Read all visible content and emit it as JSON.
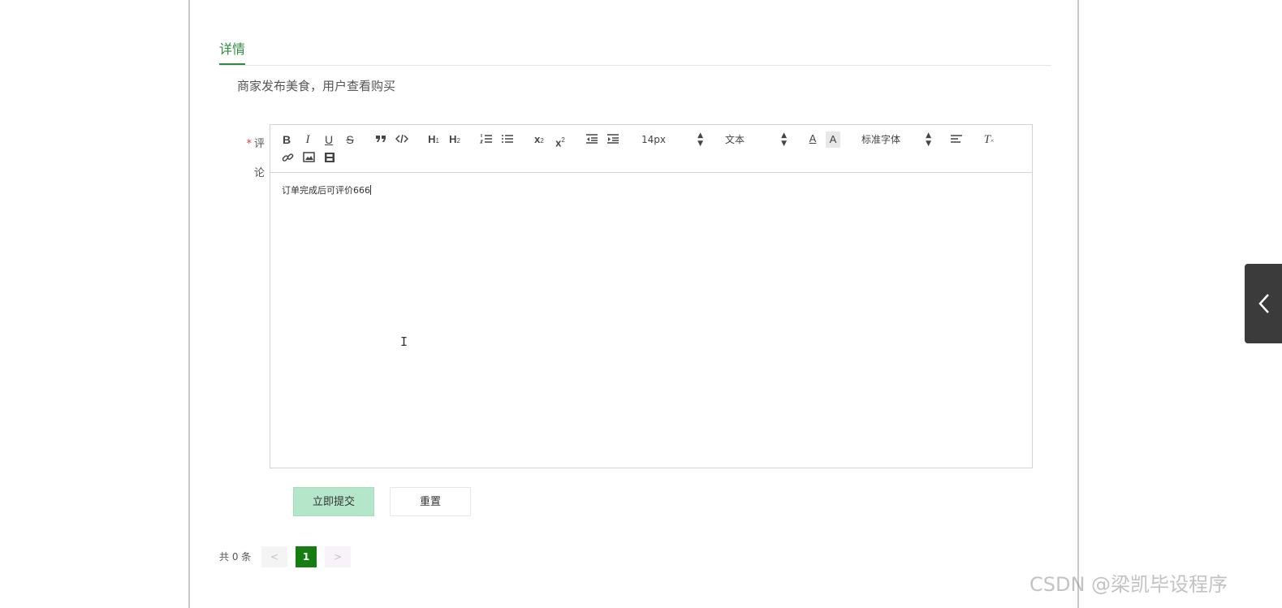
{
  "tab": {
    "title": "详情"
  },
  "description": "商家发布美食，用户查看购买",
  "form": {
    "required_mark": "*",
    "comment_label_line1": "评",
    "comment_label_line2": "论"
  },
  "editor": {
    "toolbar": {
      "bold": "B",
      "italic": "I",
      "underline": "U",
      "strike": "S",
      "h1": "H",
      "h1_sub": "1",
      "h2": "H",
      "h2_sub": "2",
      "subscript": "x",
      "subscript_sub": "2",
      "superscript": "x",
      "superscript_sup": "2",
      "size_value": "14px",
      "header_value": "文本",
      "font_value": "标准字体",
      "color_letter": "A",
      "background_letter": "A",
      "clean": "T"
    },
    "content": "订单完成后可评价666"
  },
  "buttons": {
    "submit": "立即提交",
    "reset": "重置"
  },
  "pagination": {
    "total": "共 0 条",
    "prev": "<",
    "current_page": "1",
    "next": ">"
  },
  "watermark": "CSDN @梁凯毕设程序",
  "colors": {
    "accent_green": "#2e8b3f",
    "page_active": "#157d12",
    "submit_bg": "#b4e6c9",
    "side_tab": "#3b3b3b"
  },
  "icons": [
    "quote-icon",
    "code-icon",
    "ordered-list-icon",
    "bullet-list-icon",
    "outdent-icon",
    "indent-icon",
    "align-icon",
    "link-icon",
    "image-icon",
    "video-icon",
    "chevron-left-icon"
  ]
}
